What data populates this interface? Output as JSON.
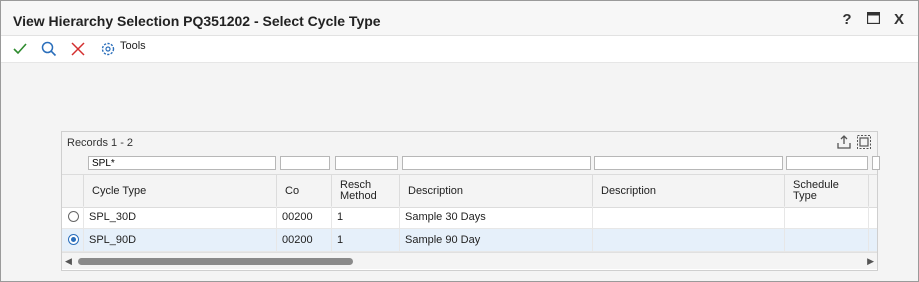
{
  "window": {
    "title": "View Hierarchy Selection PQ351202 - Select Cycle Type",
    "help": "?",
    "maximize": "",
    "close": "X"
  },
  "toolbar": {
    "tools_label": "Tools"
  },
  "grid": {
    "records": "Records 1 - 2",
    "qbe": {
      "cycle_type": "SPL*"
    },
    "columns": [
      "Cycle Type",
      "Co",
      "Resch\nMethod",
      "Description",
      "Description",
      "Schedule\nType"
    ],
    "rows": [
      {
        "selected": false,
        "cycle_type": "SPL_30D",
        "co": "00200",
        "resch": "1",
        "desc1": "Sample 30 Days",
        "desc2": "",
        "sched": ""
      },
      {
        "selected": true,
        "cycle_type": "SPL_90D",
        "co": "00200",
        "resch": "1",
        "desc1": "Sample 90 Day",
        "desc2": "",
        "sched": ""
      }
    ]
  },
  "colors": {
    "accent": "#2a6ebb",
    "selected_row": "#e6f0fa",
    "ok": "#2e8b2e",
    "cancel": "#d32f2f"
  }
}
